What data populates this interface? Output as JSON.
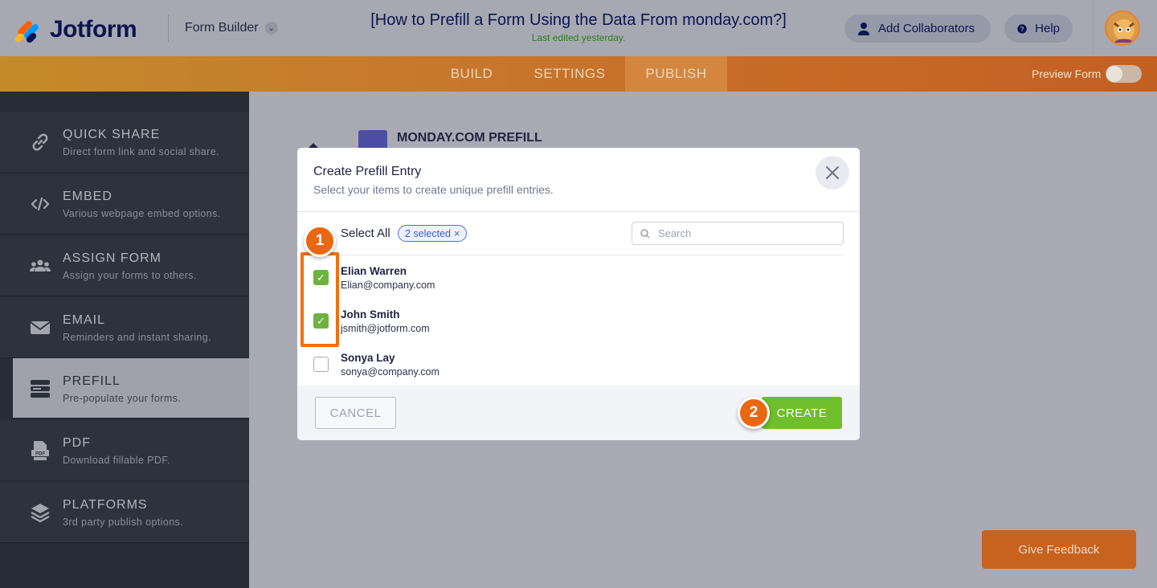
{
  "header": {
    "logo_text": "Jotform",
    "builder_label": "Form Builder",
    "title": "[How to Prefill a Form Using the Data From monday.com?]",
    "subtitle": "Last edited yesterday.",
    "add_collaborators": "Add Collaborators",
    "help": "Help"
  },
  "nav": {
    "tabs": [
      {
        "label": "BUILD"
      },
      {
        "label": "SETTINGS"
      },
      {
        "label": "PUBLISH",
        "active": true
      }
    ],
    "preview_label": "Preview Form",
    "preview_on": false
  },
  "sidebar": {
    "items": [
      {
        "title": "QUICK SHARE",
        "desc": "Direct form link and social share.",
        "icon": "link-icon"
      },
      {
        "title": "EMBED",
        "desc": "Various webpage embed options.",
        "icon": "code-icon"
      },
      {
        "title": "ASSIGN FORM",
        "desc": "Assign your forms to others.",
        "icon": "users-icon"
      },
      {
        "title": "EMAIL",
        "desc": "Reminders and instant sharing.",
        "icon": "envelope-icon"
      },
      {
        "title": "PREFILL",
        "desc": "Pre-populate your forms.",
        "icon": "prefill-icon",
        "active": true
      },
      {
        "title": "PDF",
        "desc": "Download fillable PDF.",
        "icon": "pdf-icon"
      },
      {
        "title": "PLATFORMS",
        "desc": "3rd party publish options.",
        "icon": "layers-icon"
      }
    ]
  },
  "background": {
    "section_title": "MONDAY.COM PREFILL"
  },
  "modal": {
    "title": "Create Prefill Entry",
    "subtitle": "Select your items to create unique prefill entries.",
    "select_all": "Select All",
    "selected_badge": "2 selected",
    "search_placeholder": "Search",
    "entries": [
      {
        "name": "Elian Warren",
        "email": "Elian@company.com",
        "checked": true
      },
      {
        "name": "John Smith",
        "email": "jsmith@jotform.com",
        "checked": true
      },
      {
        "name": "Sonya Lay",
        "email": "sonya@company.com",
        "checked": false
      }
    ],
    "cancel_label": "CANCEL",
    "create_label": "CREATE"
  },
  "annotations": {
    "step1": "1",
    "step2": "2"
  },
  "feedback_label": "Give Feedback",
  "colors": {
    "accent_orange": "#ea6712",
    "create_green": "#6fbe2b",
    "checkbox_green": "#6cb33f",
    "navy": "#0a1551"
  }
}
